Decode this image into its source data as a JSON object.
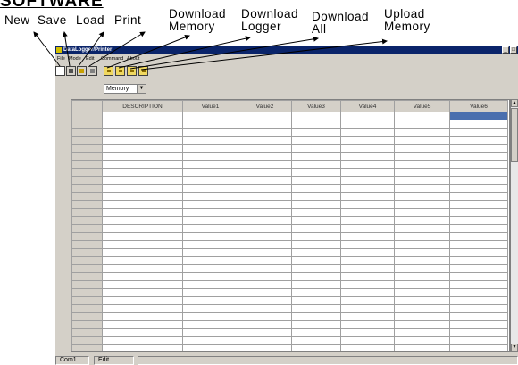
{
  "annotations": {
    "new": "New",
    "save": "Save",
    "load": "Load",
    "print": "Print",
    "download_memory": "Download\nMemory",
    "download_logger": "Download\nLogger",
    "download_all": "Download\nAll",
    "upload_memory": "Upload\nMemory"
  },
  "window": {
    "title": "DataLogger/Printer",
    "menu": [
      "File",
      "Mode",
      "Edit",
      "Command",
      "About"
    ],
    "toolbar_icons": [
      "new-icon",
      "save-icon",
      "load-icon",
      "print-icon",
      "download-memory-icon",
      "download-logger-icon",
      "download-all-icon",
      "upload-memory-icon"
    ],
    "mode_select": "Memory"
  },
  "grid": {
    "columns": [
      "DESCRIPTION",
      "Value1",
      "Value2",
      "Value3",
      "Value4",
      "Value5",
      "Value6"
    ],
    "row_count": 32,
    "selected_column": "Value6",
    "selection_color": "#4a6fae"
  },
  "status": {
    "port": "Com1",
    "mode": "Edit"
  },
  "colors": {
    "titlebar": "#0a246a",
    "chrome": "#d4d0c8"
  }
}
